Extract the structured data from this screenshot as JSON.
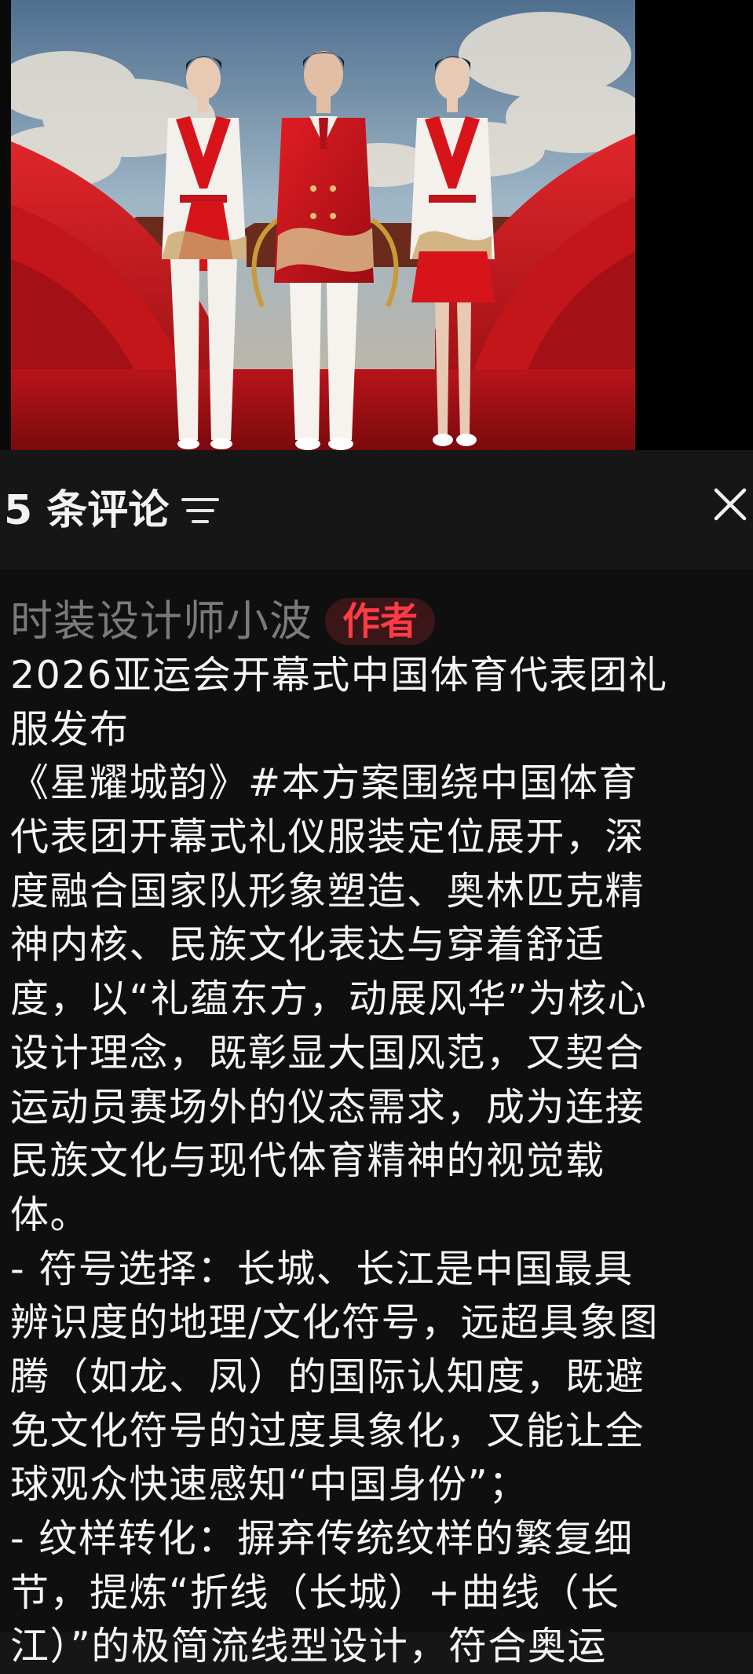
{
  "hero": {
    "alt": "三名运动员身着红白礼服"
  },
  "header": {
    "comment_count": "5 条评论",
    "sort_icon": "sort-lines-icon",
    "close_icon": "close-icon"
  },
  "comment": {
    "author": "时装设计师小波",
    "badge": "作者",
    "lines": [
      "2026亚运会开幕式中国体育代表团礼",
      "服发布",
      "《星耀城韵》#本方案围绕中国体育",
      "代表团开幕式礼仪服装定位展开，深",
      "度融合国家队形象塑造、奥林匹克精",
      "神内核、民族文化表达与穿着舒适",
      "度，以“礼蕴东方，动展风华”为核心",
      "设计理念，既彰显大国风范，又契合",
      "运动员赛场外的仪态需求，成为连接",
      "民族文化与现代体育精神的视觉载",
      "体。",
      "- 符号选择：长城、长江是中国最具",
      "辨识度的地理/文化符号，远超具象图",
      "腾（如龙、凤）的国际认知度，既避",
      "免文化符号的过度具象化，又能让全",
      "球观众快速感知“中国身份”；",
      "- 纹样转化：摒弃传统纹样的繁复细",
      "节，提炼“折线（长城）+曲线（长",
      "江）”的极简流线型设计，符合奥运"
    ]
  },
  "colors": {
    "background": "#161616",
    "accent_red": "#ff3b45",
    "author_gray": "#7a7a7a"
  }
}
